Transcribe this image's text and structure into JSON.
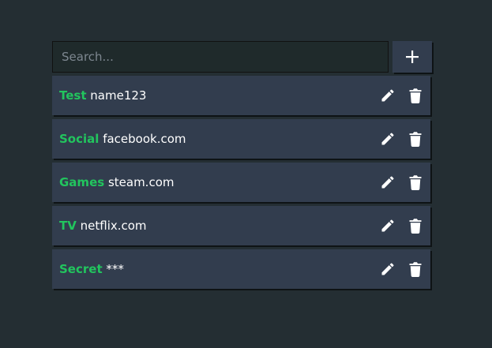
{
  "search": {
    "placeholder": "Search...",
    "value": ""
  },
  "add_button": {
    "icon": "plus-icon"
  },
  "entries": [
    {
      "category": "Test",
      "value": "name123"
    },
    {
      "category": "Social",
      "value": "facebook.com"
    },
    {
      "category": "Games",
      "value": "steam.com"
    },
    {
      "category": "TV",
      "value": "netflix.com"
    },
    {
      "category": "Secret",
      "value": "***"
    }
  ],
  "icons": {
    "edit": "pencil-icon",
    "delete": "trash-icon"
  },
  "colors": {
    "background": "#242e33",
    "card": "#323d4e",
    "accent": "#22c55e",
    "text": "#ffffff"
  }
}
